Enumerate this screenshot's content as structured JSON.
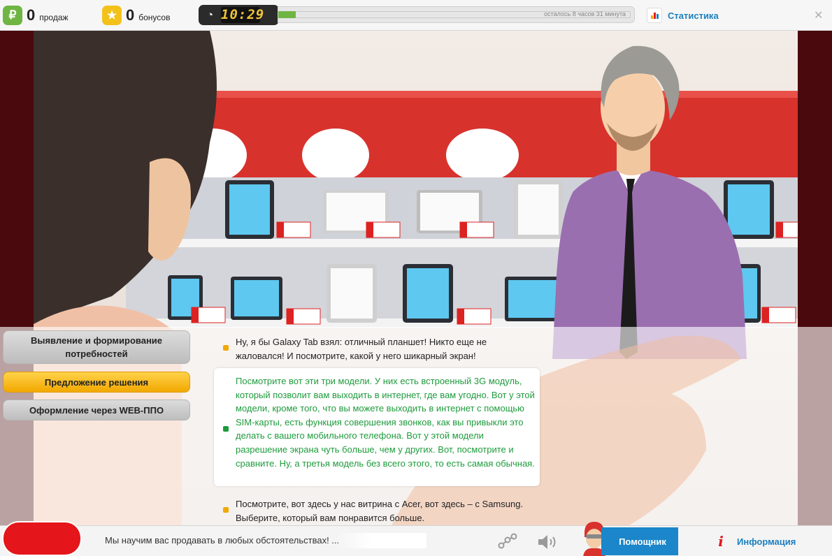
{
  "topbar": {
    "sales": {
      "count": "0",
      "label": "продаж",
      "icon": "ruble-icon",
      "glyph": "₽",
      "color": "#6fb543"
    },
    "bonus": {
      "count": "0",
      "label": "бонусов",
      "icon": "star-icon",
      "glyph": "★",
      "color": "#f2c21a"
    },
    "timer": {
      "time": "10:29",
      "remaining_text": "осталось 8 часов 31 минута",
      "progress_percent": 5
    },
    "stats": {
      "label": "Статистика",
      "icon": "bar-chart-icon"
    },
    "close": {
      "glyph": "✕",
      "icon": "close-icon"
    }
  },
  "stages": [
    {
      "label": "Выявление и формирование потребностей",
      "state": "done"
    },
    {
      "label": "Предложение решения",
      "state": "active"
    },
    {
      "label": "Оформление через WEB-ППО",
      "state": "pending"
    }
  ],
  "options": [
    {
      "text": "Ну, я бы Galaxy Tab взял: отличный планшет! Никто еще не жаловался! И посмотрите, какой у него шикарный экран!",
      "selected": false
    },
    {
      "text": "Посмотрите вот эти три модели. У них есть встроенный 3G модуль, который позволит вам выходить в интернет, где вам угодно. Вот у этой модели, кроме того, что вы можете выходить в интернет с помощью SIM-карты, есть функция совершения звонков, как вы привыкли это делать с вашего мобильного телефона. Вот у этой модели разрешение экрана чуть больше, чем у других. Вот, посмотрите и сравните. Ну, а третья модель без всего этого, то есть самая обычная.",
      "selected": true
    },
    {
      "text": "Посмотрите, вот здесь у нас витрина с Acer, вот здесь – с Samsung. Выберите, который вам понравится больше.",
      "selected": false
    }
  ],
  "bottombar": {
    "ticker": "Мы научим вас продавать в любых обстоятельствах! ...",
    "helper_label": "Помощник",
    "info_label": "Информация",
    "info_glyph": "i"
  }
}
